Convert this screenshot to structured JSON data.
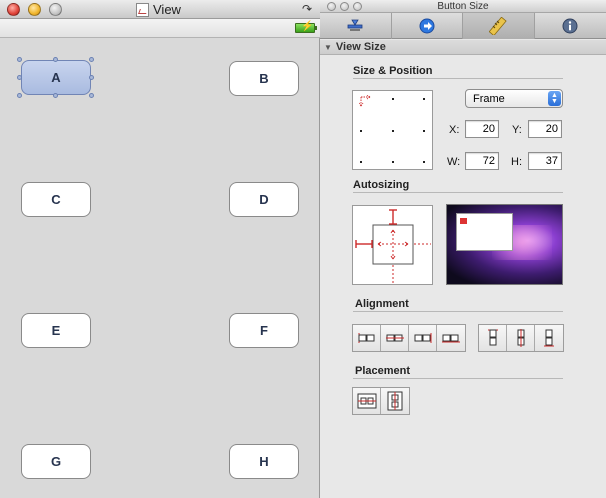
{
  "left_window": {
    "title": "View",
    "buttons": [
      "A",
      "B",
      "C",
      "D",
      "E",
      "F",
      "G",
      "H"
    ],
    "selected_button": "A"
  },
  "inspector": {
    "title": "Button Size",
    "section_title": "View Size",
    "size_position": {
      "heading": "Size & Position",
      "mode_selected": "Frame",
      "x_label": "X:",
      "x_value": "20",
      "y_label": "Y:",
      "y_value": "20",
      "w_label": "W:",
      "w_value": "72",
      "h_label": "H:",
      "h_value": "37"
    },
    "autosizing_heading": "Autosizing",
    "alignment_heading": "Alignment",
    "placement_heading": "Placement"
  },
  "colors": {
    "selection_fill": "#b7c6e8",
    "button_text": "#27344f",
    "autosize_red": "#cc2a2a",
    "select_arrow_blue": "#2a6ed8"
  }
}
